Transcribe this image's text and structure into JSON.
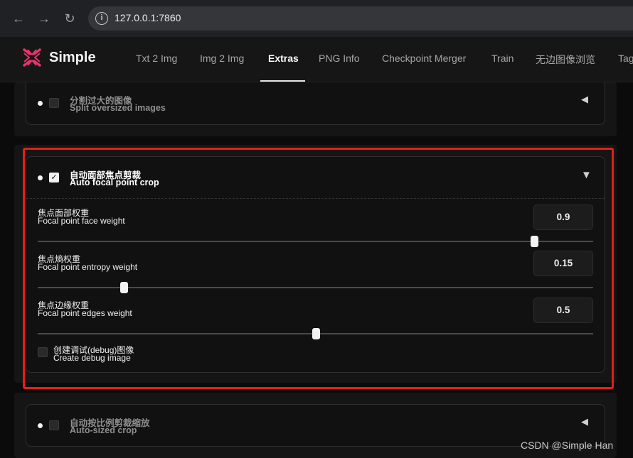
{
  "browser": {
    "url": "127.0.0.1:7860",
    "back_icon": "arrow-left-icon",
    "forward_icon": "arrow-right-icon",
    "reload_icon": "reload-icon"
  },
  "app": {
    "title": "Simple",
    "brand_color": "#e8336d",
    "tabs": [
      {
        "label": "Txt 2 Img"
      },
      {
        "label": "Img 2 Img"
      },
      {
        "label": "Extras"
      },
      {
        "label": "PNG Info"
      },
      {
        "label": "Checkpoint Merger"
      },
      {
        "label": "Train"
      },
      {
        "label": "无边图像浏览"
      },
      {
        "label": "Tag"
      }
    ],
    "active_tab": "Extras"
  },
  "sections": {
    "split": {
      "label_cn": "分割过大的图像",
      "label_en": "Split oversized images",
      "checked": false,
      "expanded": false
    },
    "focal": {
      "label_cn": "自动面部焦点剪裁",
      "label_en": "Auto focal point crop",
      "checked": true,
      "expanded": true,
      "face": {
        "label_cn": "焦点面部权重",
        "label_en": "Focal point face weight",
        "value": "0.9"
      },
      "entropy": {
        "label_cn": "焦点熵权重",
        "label_en": "Focal point entropy weight",
        "value": "0.15"
      },
      "edges": {
        "label_cn": "焦点边缘权重",
        "label_en": "Focal point edges weight",
        "value": "0.5"
      },
      "debug": {
        "label_cn": "创建调试(debug)图像",
        "label_en": "Create debug image",
        "checked": false
      }
    },
    "autosize": {
      "label_cn": "自动按比例剪裁缩放",
      "label_en": "Auto-sized crop",
      "checked": false,
      "expanded": false
    }
  },
  "highlight_color": "#e0201a",
  "watermark": "CSDN @Simple Han"
}
